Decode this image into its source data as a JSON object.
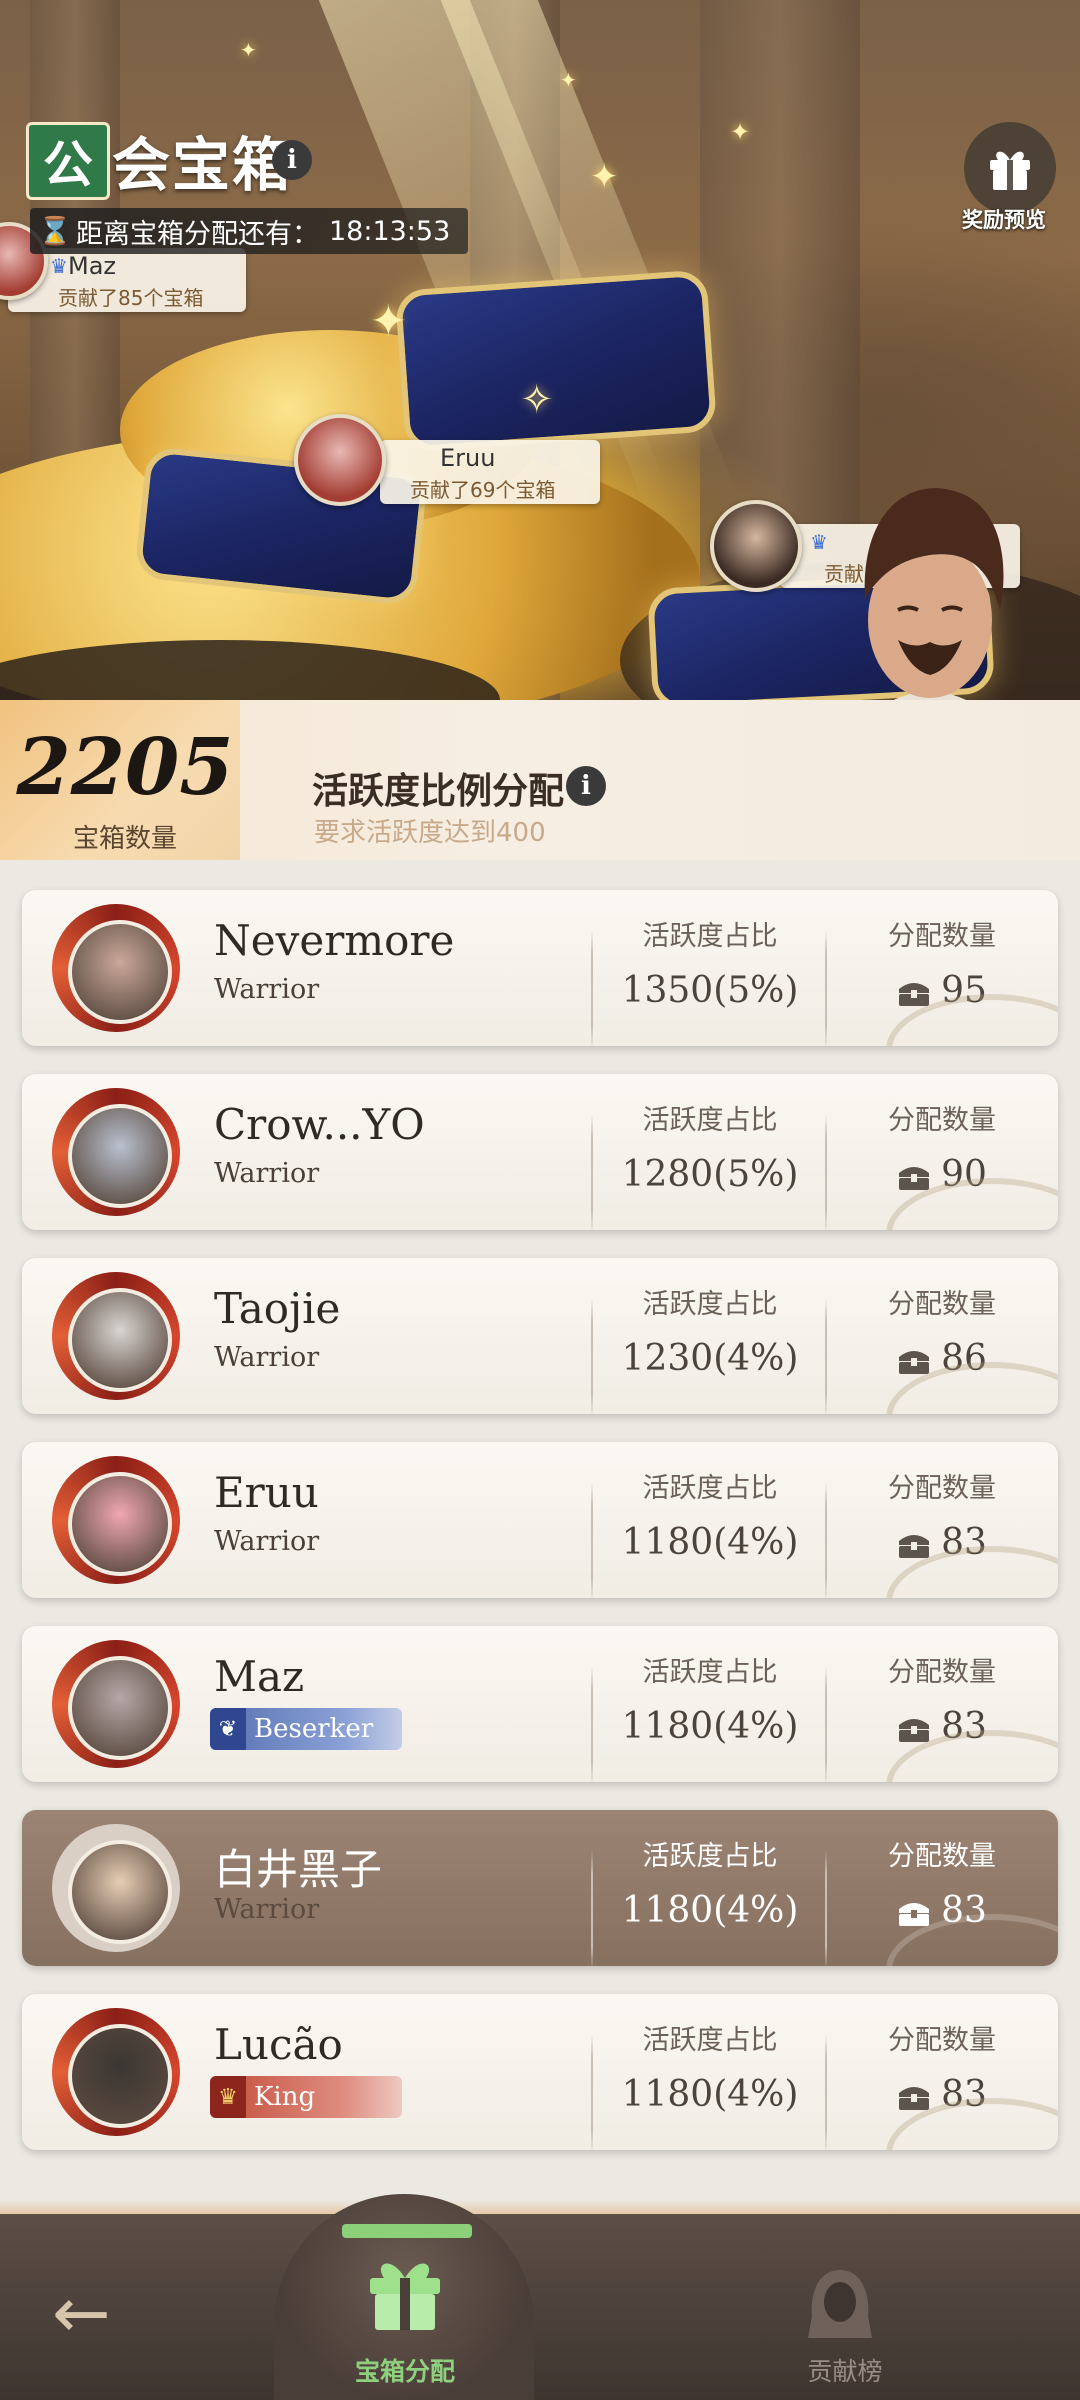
{
  "header": {
    "title_char": "公",
    "title_rest": "会宝箱",
    "info_icon": "info-icon",
    "countdown_label": "距离宝箱分配还有：",
    "countdown_time": "18:13:53",
    "reward_preview_label": "奖励预览"
  },
  "contributors": [
    {
      "name": "Maz",
      "text": "贡献了85个宝箱"
    },
    {
      "name": "Eruu",
      "text": "贡献了69个宝箱"
    },
    {
      "name": "",
      "text": "贡献"
    }
  ],
  "stats": {
    "box_count": "2205",
    "box_count_label": "宝箱数量",
    "mode_title": "活跃度比例分配",
    "mode_requirement": "要求活跃度达到400"
  },
  "columns": {
    "activity": "活跃度占比",
    "allocation": "分配数量"
  },
  "members": [
    {
      "name": "Nevermore",
      "role": "Warrior",
      "badge": "",
      "activity": "1350(5%)",
      "allocation": "95",
      "mine": false
    },
    {
      "name": "Crow...YO",
      "role": "Warrior",
      "badge": "",
      "activity": "1280(5%)",
      "allocation": "90",
      "mine": false
    },
    {
      "name": "Taojie",
      "role": "Warrior",
      "badge": "",
      "activity": "1230(4%)",
      "allocation": "86",
      "mine": false
    },
    {
      "name": "Eruu",
      "role": "Warrior",
      "badge": "",
      "activity": "1180(4%)",
      "allocation": "83",
      "mine": false
    },
    {
      "name": "Maz",
      "role": "Beserker",
      "badge": "beserker",
      "activity": "1180(4%)",
      "allocation": "83",
      "mine": false
    },
    {
      "name": "白井黑子",
      "role": "Warrior",
      "badge": "",
      "activity": "1180(4%)",
      "allocation": "83",
      "mine": true
    },
    {
      "name": "Lucão",
      "role": "King",
      "badge": "king",
      "activity": "1180(4%)",
      "allocation": "83",
      "mine": false
    }
  ],
  "nav": {
    "back_icon": "back-arrow-icon",
    "tab_distribution": "宝箱分配",
    "tab_ranking": "贡献榜"
  },
  "colors": {
    "active_tab": "#8fd07f",
    "mine_row": "#8f7868",
    "title_green": "#2f7a48"
  }
}
